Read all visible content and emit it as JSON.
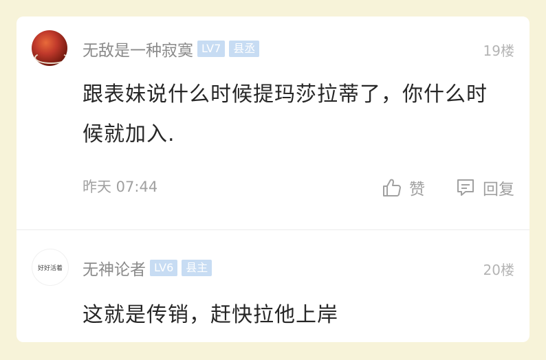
{
  "comments": [
    {
      "username": "无敌是一种寂寞",
      "level": "LV7",
      "title": "县丞",
      "floor": "19楼",
      "content": "跟表妹说什么时候提玛莎拉蒂了，你什么时候就加入.",
      "time": "昨天 07:44",
      "like_label": "赞",
      "reply_label": "回复"
    },
    {
      "username": "无神论者",
      "level": "LV6",
      "title": "县主",
      "floor": "20楼",
      "content": "这就是传销，赶快拉他上岸",
      "avatar_text": "好好活着"
    }
  ],
  "colors": {
    "background": "#f7f3d9",
    "badge": "#c7dcf3",
    "username": "#8a8a8a",
    "content": "#262626"
  },
  "icons": [
    "thumbs-up-icon",
    "comment-icon"
  ]
}
